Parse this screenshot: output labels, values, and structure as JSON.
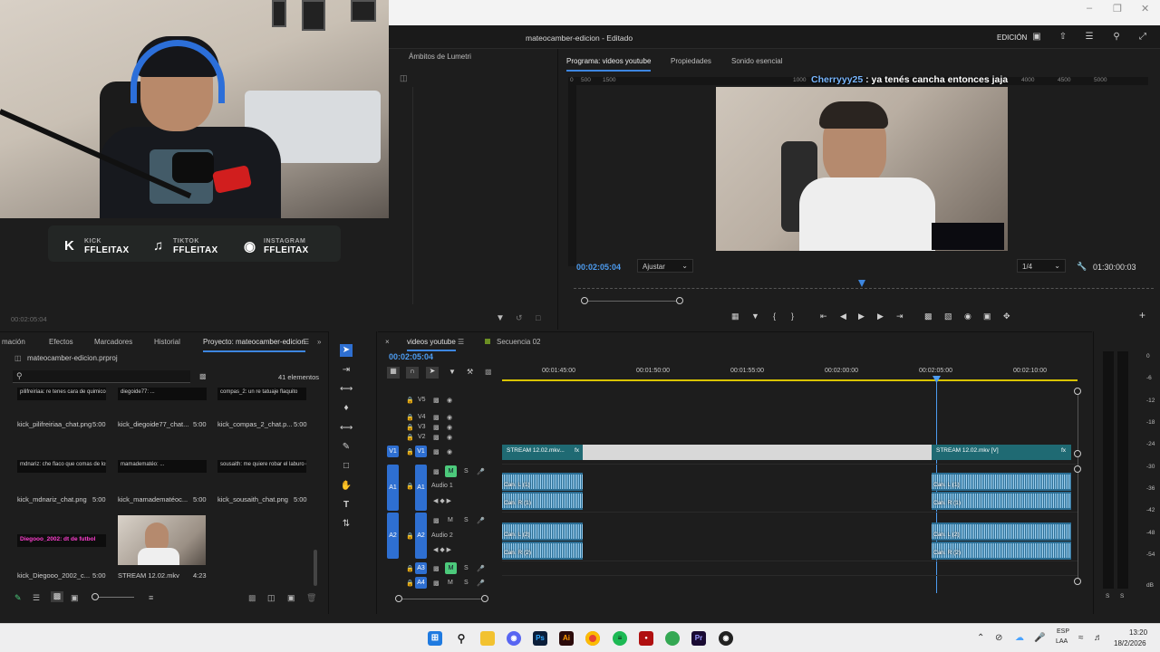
{
  "window": {
    "title": "mateocamber-edicion - Editado",
    "workspace": "EDICIÓN"
  },
  "overlay": {
    "socials": [
      {
        "platform": "KICK",
        "handle": "FFLEITAX",
        "icon": "kick-icon"
      },
      {
        "platform": "TIKTOK",
        "handle": "FFLEITAX",
        "icon": "tiktok-icon"
      },
      {
        "platform": "INSTAGRAM",
        "handle": "FFLEITAX",
        "icon": "instagram-icon"
      }
    ]
  },
  "source": {
    "timecode": "00:02:05:04",
    "panel_tab": "Ámbitos de Lumetri"
  },
  "program": {
    "tabs": [
      "Programa: videos youtube",
      "Propiedades",
      "Sonido esencial"
    ],
    "timecode": "00:02:05:04",
    "fit": "Ajustar",
    "resolution": "1/4",
    "duration": "01:30:00:03",
    "ruler": [
      "0",
      "500",
      "1000",
      "1500",
      "4000",
      "4500",
      "5000"
    ],
    "chat_user": "Cherryyy25",
    "chat_text": " : ya tenés cancha entonces jaja"
  },
  "project": {
    "tabs": [
      "mación",
      "Efectos",
      "Marcadores",
      "Historial",
      "Proyecto: mateocamber-edicion"
    ],
    "file": "mateocamber-edicion.prproj",
    "count": "41 elementos",
    "thumb_snippets": [
      "pilifreiriaa: re tenes cara de quimico",
      "diegoide77: ...",
      "compas_2: un re tatuaje flaquito",
      "mdnariz: che flaco que comas de los ter",
      "mamadematéo: ...",
      "sousaith: me quiere robar el laburo che",
      "Diegooo_2002: dt de futbol"
    ],
    "items": [
      {
        "name": "kick_pilifreiriaa_chat.png",
        "duration": "5:00"
      },
      {
        "name": "kick_diegoide77_chat...",
        "duration": "5:00"
      },
      {
        "name": "kick_compas_2_chat.p...",
        "duration": "5:00"
      },
      {
        "name": "kick_mdnariz_chat.png",
        "duration": "5:00"
      },
      {
        "name": "kick_mamadematéoc...",
        "duration": "5:00"
      },
      {
        "name": "kick_sousaith_chat.png",
        "duration": "5:00"
      },
      {
        "name": "kick_Diegooo_2002_c...",
        "duration": "5:00"
      },
      {
        "name": "STREAM 12.02.mkv",
        "duration": "4:23"
      }
    ]
  },
  "timeline": {
    "tabs": [
      "videos youtube",
      "Secuencia 02"
    ],
    "timecode": "00:02:05:04",
    "ruler": [
      "00:01:45:00",
      "00:01:50:00",
      "00:01:55:00",
      "00:02:00:00",
      "00:02:05:00",
      "00:02:10:00"
    ],
    "video_tracks": [
      "V5",
      "V4",
      "V3",
      "V2",
      "V1"
    ],
    "audio_tracks": [
      {
        "id": "A1",
        "name": "Audio 1"
      },
      {
        "id": "A2",
        "name": "Audio 2"
      },
      {
        "id": "A3",
        "name": ""
      },
      {
        "id": "A4",
        "name": ""
      }
    ],
    "clips": {
      "v1_left": "STREAM 12.02.mkv...",
      "v1_right": "STREAM 12.02.mkv [V]",
      "a1_l": "Can. L (1)",
      "a1_r": "Can. R (1)",
      "a2_l": "Can. L (2)",
      "a2_r": "Can. R (2)"
    },
    "db_scale": [
      "0",
      "-6",
      "-12",
      "-18",
      "-24",
      "-30",
      "-36",
      "-42",
      "-48",
      "-54",
      "dB"
    ],
    "meter_solo": [
      "S",
      "S"
    ]
  },
  "taskbar": {
    "lang1": "ESP",
    "lang2": "LAA",
    "time": "13:20",
    "date": "18/2/2026"
  },
  "colors": {
    "accent": "#3d86e0",
    "timecode": "#4d9cf0",
    "track_blue": "#2e6fd1",
    "mute_green": "#4cc97b"
  }
}
